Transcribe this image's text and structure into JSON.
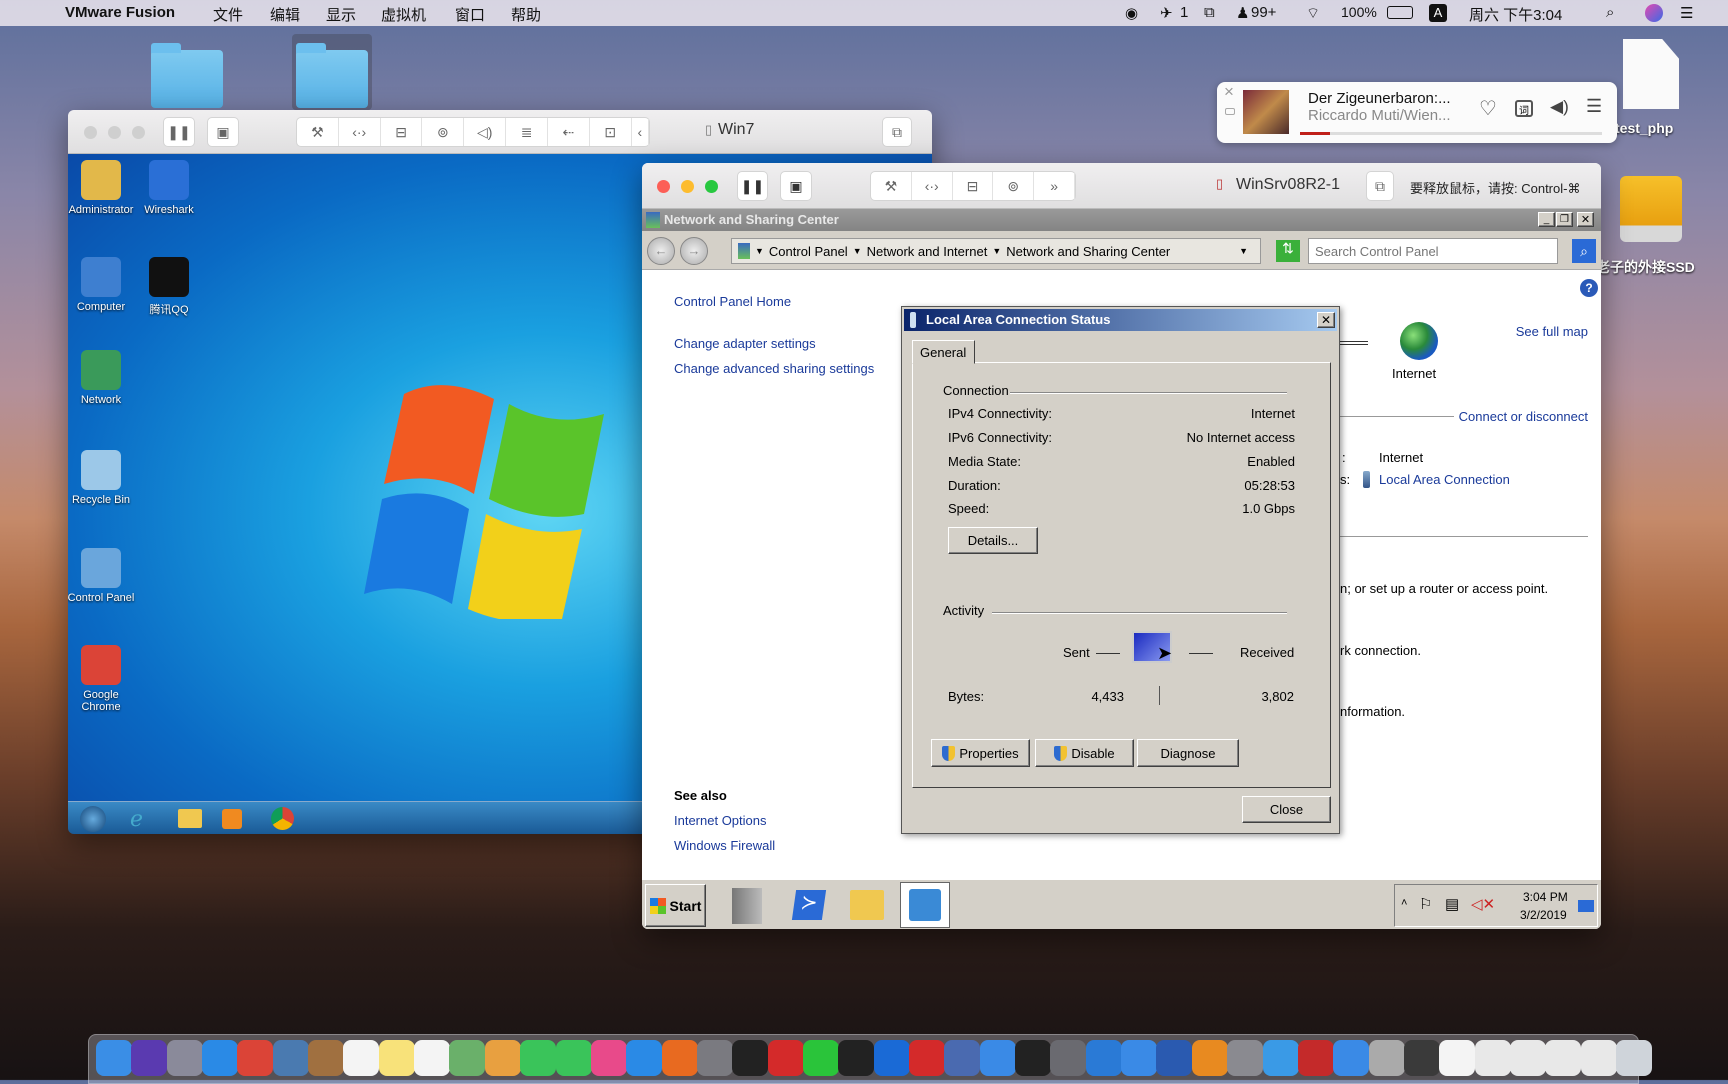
{
  "menubar": {
    "app_name": "VMware Fusion",
    "menus": [
      "文件",
      "编辑",
      "显示",
      "虚拟机",
      "窗口",
      "帮助"
    ],
    "status": {
      "notif_count_1": "1",
      "qq_badge": "99+",
      "battery": "100%",
      "input_method": "A",
      "clock": "周六 下午3:04"
    }
  },
  "music": {
    "title": "Der Zigeunerbaron:...",
    "artist": "Riccardo Muti/Wien...",
    "progress": 0.1,
    "accent": "#c0201a"
  },
  "desktop": {
    "files": [
      {
        "label": "test_php"
      },
      {
        "label": "老子的外接SSD"
      }
    ]
  },
  "win7_vm": {
    "title": "Win7",
    "icons": [
      {
        "label": "Administrator",
        "color": "#e2b84a"
      },
      {
        "label": "Wireshark",
        "color": "#2a6fd6"
      },
      {
        "label": "Computer",
        "color": "#3e7fd0"
      },
      {
        "label": "腾讯QQ",
        "color": "#111111"
      },
      {
        "label": "Network",
        "color": "#3a9a5a"
      },
      {
        "label": "Recycle Bin",
        "color": "#9cc8e8"
      },
      {
        "label": "Control Panel",
        "color": "#6aa6dc"
      },
      {
        "label": "Google Chrome",
        "color": "#db4437"
      }
    ]
  },
  "server_vm": {
    "title": "WinSrv08R2-1",
    "release_hint": "要释放鼠标，请按: Control-⌘"
  },
  "nsc": {
    "window_title": "Network and Sharing Center",
    "breadcrumb": [
      "Control Panel",
      "Network and Internet",
      "Network and Sharing Center"
    ],
    "search_placeholder": "Search Control Panel",
    "left_links": [
      "Control Panel Home",
      "Change adapter settings",
      "Change advanced sharing settings"
    ],
    "see_also_heading": "See also",
    "see_also": [
      "Internet Options",
      "Windows Firewall"
    ],
    "map": {
      "internet_label": "Internet",
      "see_full_map": "See full map"
    },
    "connect_or_disconnect": "Connect or disconnect",
    "access_type_suffix": ":",
    "access_type_value": "Internet",
    "connections_suffix": "s:",
    "connection_link": "Local Area Connection",
    "frag1": "n; or set up a router or access point.",
    "frag2": "rk connection.",
    "frag3": "nformation."
  },
  "dialog": {
    "title": "Local Area Connection Status",
    "tab": "General",
    "connection_heading": "Connection",
    "rows": [
      {
        "label": "IPv4 Connectivity:",
        "value": "Internet"
      },
      {
        "label": "IPv6 Connectivity:",
        "value": "No Internet access"
      },
      {
        "label": "Media State:",
        "value": "Enabled"
      },
      {
        "label": "Duration:",
        "value": "05:28:53"
      },
      {
        "label": "Speed:",
        "value": "1.0 Gbps"
      }
    ],
    "details_button": "Details...",
    "activity_heading": "Activity",
    "sent_label": "Sent",
    "received_label": "Received",
    "bytes_label": "Bytes:",
    "bytes_sent": "4,433",
    "bytes_received": "3,802",
    "properties_button": "Properties",
    "disable_button": "Disable",
    "diagnose_button": "Diagnose",
    "close_button": "Close"
  },
  "server_taskbar": {
    "start": "Start",
    "time": "3:04 PM",
    "date": "3/2/2019"
  },
  "dock": {
    "apps": [
      {
        "name": "finder",
        "color": "#3a8ee6"
      },
      {
        "name": "siri",
        "color": "#5a3ab0"
      },
      {
        "name": "launchpad",
        "color": "#8a8a9a"
      },
      {
        "name": "safari",
        "color": "#2a8ae6"
      },
      {
        "name": "chrome",
        "color": "#db4437"
      },
      {
        "name": "preview",
        "color": "#4a7ab0"
      },
      {
        "name": "contacts",
        "color": "#a07040"
      },
      {
        "name": "calendar",
        "color": "#f4f4f4"
      },
      {
        "name": "notes",
        "color": "#f8e27a"
      },
      {
        "name": "reminders",
        "color": "#f4f4f4"
      },
      {
        "name": "maps",
        "color": "#6ab06a"
      },
      {
        "name": "photos",
        "color": "#e8a040"
      },
      {
        "name": "messages",
        "color": "#3ac45a"
      },
      {
        "name": "facetime",
        "color": "#3ac45a"
      },
      {
        "name": "itunes",
        "color": "#e84a8a"
      },
      {
        "name": "app-store",
        "color": "#2a8ae6"
      },
      {
        "name": "firefox",
        "color": "#e86a20"
      },
      {
        "name": "system-preferences",
        "color": "#7a7a80"
      },
      {
        "name": "terminal",
        "color": "#222222"
      },
      {
        "name": "netease-music",
        "color": "#d42a2a"
      },
      {
        "name": "wechat",
        "color": "#2ac43a"
      },
      {
        "name": "qq",
        "color": "#222222"
      },
      {
        "name": "teamviewer",
        "color": "#1a6ad6"
      },
      {
        "name": "parallels",
        "color": "#d42a2a"
      },
      {
        "name": "virtualbox",
        "color": "#4a6ab0"
      },
      {
        "name": "xcode",
        "color": "#3a8ae6"
      },
      {
        "name": "pycharm",
        "color": "#222222"
      },
      {
        "name": "vmware",
        "color": "#6a6a70"
      },
      {
        "name": "vscode",
        "color": "#2a7ad6"
      },
      {
        "name": "baidu-netdisk",
        "color": "#3a8ae6"
      },
      {
        "name": "word",
        "color": "#2a5ab0"
      },
      {
        "name": "sublime",
        "color": "#e88a20"
      },
      {
        "name": "automator",
        "color": "#8a8a90"
      },
      {
        "name": "qq-mail",
        "color": "#3a9ae6"
      },
      {
        "name": "filezilla",
        "color": "#c42a2a"
      },
      {
        "name": "feishu",
        "color": "#3a8ae6"
      },
      {
        "name": "mail",
        "color": "#aaaaaa"
      },
      {
        "name": "quicktime",
        "color": "#3a3a3a"
      },
      {
        "name": "doc-1",
        "color": "#f4f4f4"
      },
      {
        "name": "doc-2",
        "color": "#e8e8e8"
      },
      {
        "name": "doc-3",
        "color": "#e8e8e8"
      },
      {
        "name": "doc-4",
        "color": "#e8e8e8"
      },
      {
        "name": "doc-5",
        "color": "#e8e8e8"
      },
      {
        "name": "trash",
        "color": "#cfd4da"
      }
    ]
  }
}
